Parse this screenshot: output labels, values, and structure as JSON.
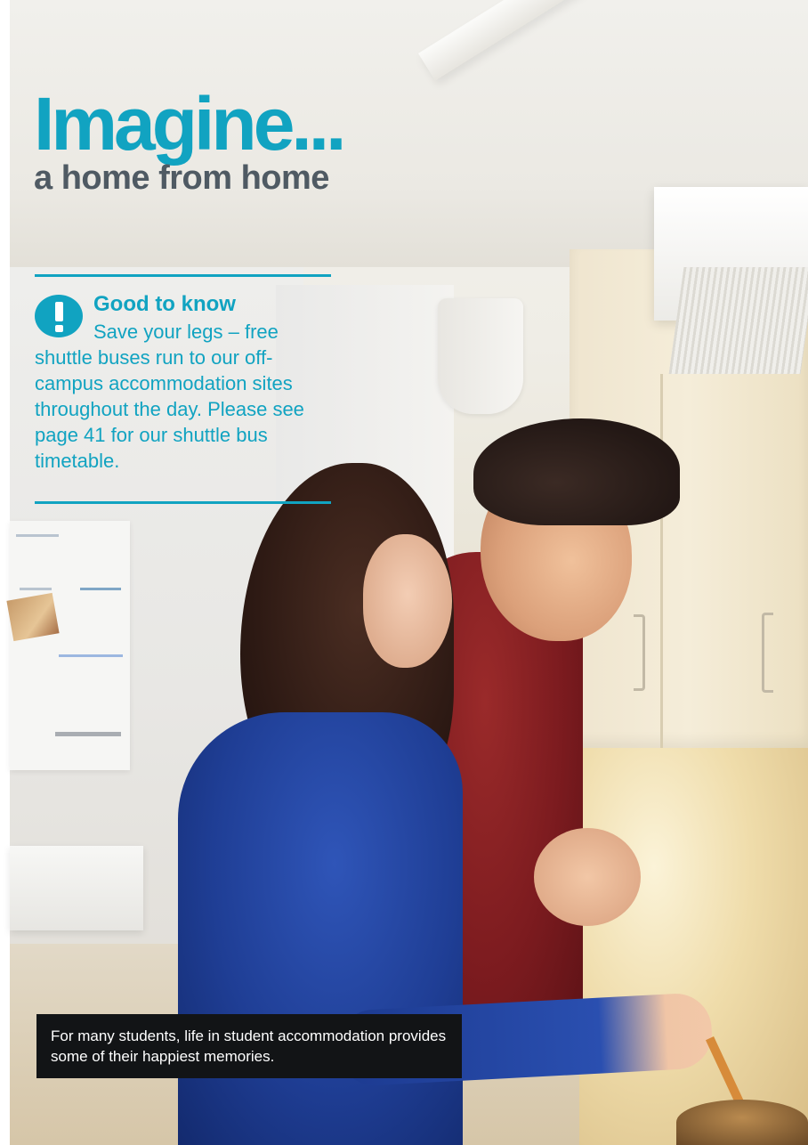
{
  "headline": {
    "title": "Imagine...",
    "subtitle": "a home from home"
  },
  "info_box": {
    "icon": "exclamation-icon",
    "title": "Good to know",
    "body": "Save your legs – free shuttle buses run to our off-campus accommodation sites throughout the day. Please see page 41 for our shuttle bus timetable."
  },
  "caption": {
    "text": "For many students, life in student accommodation provides some of their happiest memories."
  },
  "colors": {
    "accent": "#11a3c1",
    "subtitle": "#4f5a63",
    "caption_bg": "#121416",
    "caption_text": "#ffffff"
  }
}
